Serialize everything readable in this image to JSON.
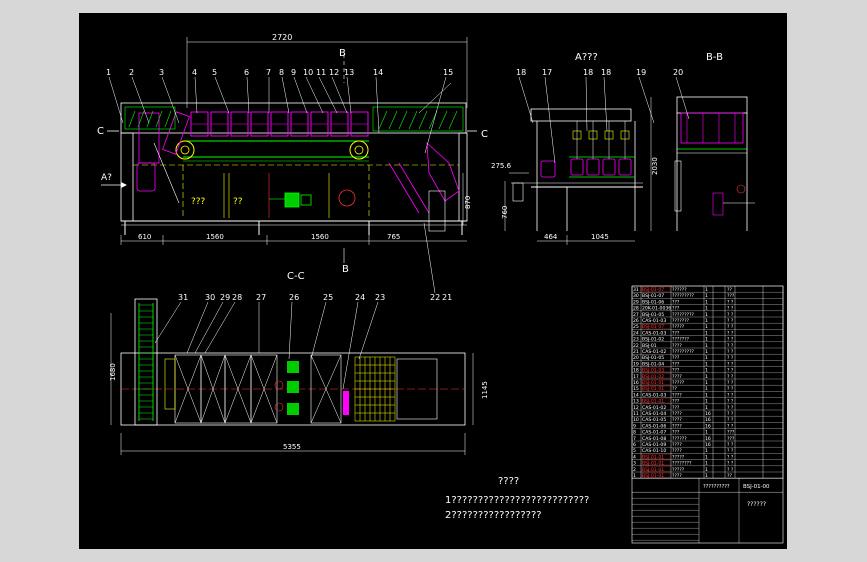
{
  "views": {
    "front_label": "A???",
    "side_label": "B-B",
    "plan_label": "C-C",
    "marker_b": "B",
    "marker_c": "C",
    "marker_a": "A?",
    "qq1": "???",
    "qq2": "??"
  },
  "dimensions": {
    "overall_length": "2720",
    "seg_610": "610",
    "seg_1560a": "1560",
    "seg_1560b": "1560",
    "seg_765": "765",
    "height_870": "870",
    "side_2030": "2030",
    "side_760": "760",
    "side_275": "275.6",
    "side_464": "464",
    "side_1045": "1045",
    "plan_1680": "1680",
    "plan_1145": "1145",
    "plan_5355": "5355"
  },
  "balloons_front": [
    "1",
    "2",
    "3",
    "4",
    "5",
    "6",
    "7",
    "8",
    "9",
    "10",
    "11",
    "12",
    "13",
    "14",
    "15"
  ],
  "balloons_side": [
    "18",
    "17",
    "18",
    "18",
    "19",
    "20"
  ],
  "balloons_plan": [
    "31",
    "30",
    "29",
    "28",
    "27",
    "26",
    "25",
    "24",
    "23"
  ],
  "balloons_misc": [
    "22",
    "21"
  ],
  "notes": {
    "title": "????",
    "line1": "1??????????????????????????",
    "line2": "2?????????????????"
  },
  "bom": {
    "rows": [
      {
        "no": "31",
        "code": "BSJ-01-07",
        "name": "??????",
        "qty": "1",
        "mat": "??",
        "flag": true
      },
      {
        "no": "30",
        "code": "BSJ-01-07",
        "name": "?????????",
        "qty": "1",
        "mat": "???",
        "flag": false
      },
      {
        "no": "29",
        "code": "BSJ-01-06",
        "name": "???",
        "qty": "1",
        "mat": "? ?",
        "flag": false
      },
      {
        "no": "28",
        "code": "20K-01-0036",
        "name": "???",
        "qty": "1",
        "mat": "? ?",
        "flag": false
      },
      {
        "no": "27",
        "code": "BSJ-01-05",
        "name": "?????????",
        "qty": "1",
        "mat": "? ?",
        "flag": false
      },
      {
        "no": "26",
        "code": "CAS-01-03",
        "name": "???????",
        "qty": "1",
        "mat": "? ?",
        "flag": false
      },
      {
        "no": "25",
        "code": "BSJ-01-07",
        "name": "?????",
        "qty": "1",
        "mat": "? ?",
        "flag": true
      },
      {
        "no": "24",
        "code": "CAS-01-03",
        "name": "???",
        "qty": "1",
        "mat": "? ?",
        "flag": false
      },
      {
        "no": "23",
        "code": "BSJ-01-02",
        "name": "???????",
        "qty": "1",
        "mat": "? ?",
        "flag": false
      },
      {
        "no": "22",
        "code": "BSJ-01",
        "name": "????",
        "qty": "1",
        "mat": "? ?",
        "flag": false
      },
      {
        "no": "21",
        "code": "CAS-01-02",
        "name": "?????????",
        "qty": "1",
        "mat": "? ?",
        "flag": false
      },
      {
        "no": "20",
        "code": "BSJ-01-05",
        "name": "???",
        "qty": "1",
        "mat": "? ?",
        "flag": false
      },
      {
        "no": "19",
        "code": "BSJ-01-04",
        "name": "???",
        "qty": "1",
        "mat": "? ?",
        "flag": false
      },
      {
        "no": "18",
        "code": "BSJ-01-03",
        "name": "???",
        "qty": "1",
        "mat": "? ?",
        "flag": true
      },
      {
        "no": "17",
        "code": "BSJ-01-02",
        "name": "????",
        "qty": "1",
        "mat": "? ?",
        "flag": true
      },
      {
        "no": "16",
        "code": "BSJ-01-01",
        "name": "?????",
        "qty": "1",
        "mat": "? ?",
        "flag": true
      },
      {
        "no": "15",
        "code": "BSJ-01-01",
        "name": "??",
        "qty": "1",
        "mat": "? ?",
        "flag": true
      },
      {
        "no": "14",
        "code": "CAS-01-03",
        "name": "????",
        "qty": "1",
        "mat": "? ?",
        "flag": false
      },
      {
        "no": "13",
        "code": "BSJ-01-01",
        "name": "???",
        "qty": "1",
        "mat": "? ?",
        "flag": true
      },
      {
        "no": "12",
        "code": "CAS-01-02",
        "name": "???",
        "qty": "1",
        "mat": "? ?",
        "flag": false
      },
      {
        "no": "11",
        "code": "CAS-01-04",
        "name": "????",
        "qty": "16",
        "mat": "? ?",
        "flag": false
      },
      {
        "no": "10",
        "code": "CAS-01-05",
        "name": "????",
        "qty": "16",
        "mat": "? ?",
        "flag": false
      },
      {
        "no": "9",
        "code": "CAS-01-06",
        "name": "????",
        "qty": "16",
        "mat": "? ?",
        "flag": false
      },
      {
        "no": "8",
        "code": "CAS-01-07",
        "name": "???",
        "qty": "1",
        "mat": "???",
        "flag": false
      },
      {
        "no": "7",
        "code": "CAS-01-08",
        "name": "??????",
        "qty": "16",
        "mat": "???",
        "flag": false
      },
      {
        "no": "6",
        "code": "CAS-01-09",
        "name": "????",
        "qty": "16",
        "mat": "? ?",
        "flag": false
      },
      {
        "no": "5",
        "code": "CAS-01-10",
        "name": "????",
        "qty": "1",
        "mat": "? ?",
        "flag": false
      },
      {
        "no": "4",
        "code": "BSJ-01-01",
        "name": "?????",
        "qty": "1",
        "mat": "? ?",
        "flag": true
      },
      {
        "no": "3",
        "code": "BSJ-01-01",
        "name": "????????",
        "qty": "1",
        "mat": "? ?",
        "flag": true
      },
      {
        "no": "2",
        "code": "BSJ-01-01",
        "name": "?????",
        "qty": "1",
        "mat": "? ?",
        "flag": true
      },
      {
        "no": "1",
        "code": "BSJ-01-01",
        "name": "????",
        "qty": "1",
        "mat": "??",
        "flag": true
      }
    ],
    "title_block": {
      "drawing_no": "BSJ-01-00",
      "name": "??????????",
      "company": "??????"
    }
  }
}
